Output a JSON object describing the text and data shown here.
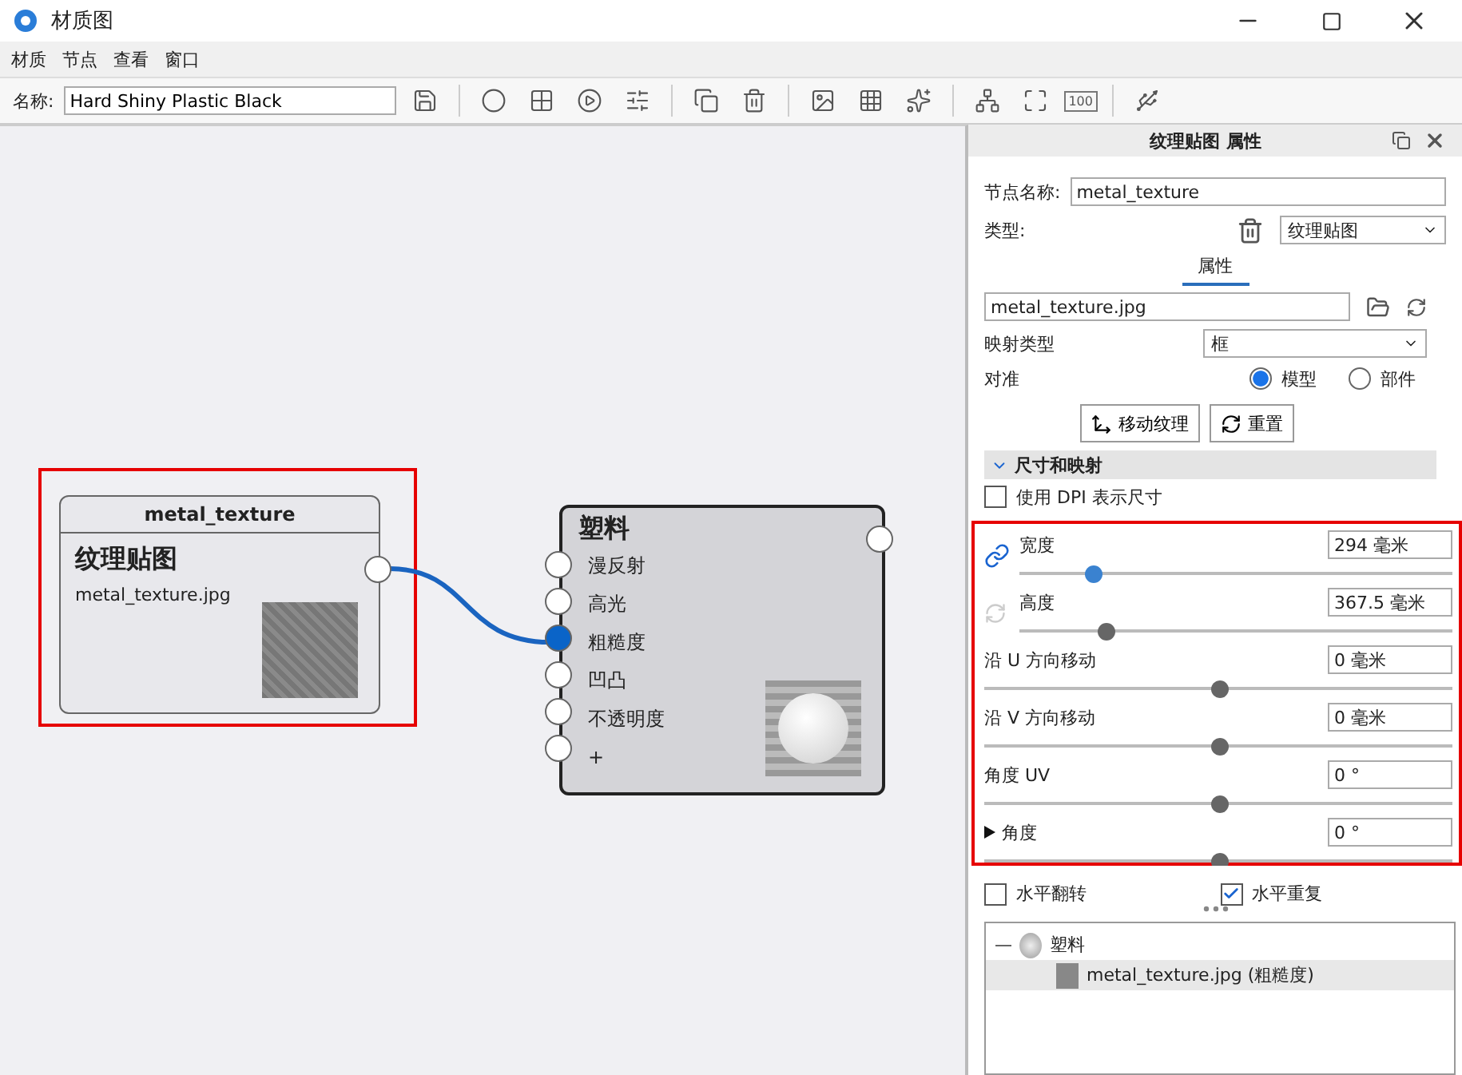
{
  "window": {
    "title": "材质图"
  },
  "menu": [
    {
      "label": "材质"
    },
    {
      "label": "节点"
    },
    {
      "label": "查看"
    },
    {
      "label": "窗口"
    }
  ],
  "toolbar": {
    "name_label": "名称:",
    "name_value": "Hard Shiny Plastic Black",
    "zoom_label": "100"
  },
  "canvas": {
    "nodes": [
      {
        "kind": "texture",
        "title": "metal_texture",
        "type": "纹理贴图",
        "file": "metal_texture.jpg",
        "highlighted": true
      },
      {
        "kind": "material",
        "title": "塑料",
        "inputs": [
          {
            "label": "漫反射",
            "connected": false
          },
          {
            "label": "高光",
            "connected": false
          },
          {
            "label": "粗糙度",
            "connected": true
          },
          {
            "label": "凹凸",
            "connected": false
          },
          {
            "label": "不透明度",
            "connected": false
          },
          {
            "label": "+",
            "connected": false
          }
        ]
      }
    ]
  },
  "panel": {
    "title": "纹理贴图 属性",
    "node_name_label": "节点名称:",
    "node_name": "metal_texture",
    "type_label": "类型:",
    "type_value": "纹理贴图",
    "tabs": [
      {
        "label": "属性",
        "selected": true
      }
    ],
    "file": "metal_texture.jpg",
    "mapping_label": "映射类型",
    "mapping_value": "框",
    "align_label": "对准",
    "align_options": [
      {
        "label": "模型",
        "selected": true
      },
      {
        "label": "部件",
        "selected": false
      }
    ],
    "buttons": [
      {
        "kind": "move",
        "label": "移动纹理"
      },
      {
        "kind": "reset",
        "label": "重置"
      }
    ],
    "section": {
      "title": "尺寸和映射",
      "expanded": true
    },
    "dpi": {
      "label": "使用 DPI 表示尺寸",
      "checked": false
    },
    "sliders_highlighted": true,
    "sliders": [
      {
        "kind": "linked",
        "label": "宽度",
        "value": "294 毫米",
        "level": 0.17
      },
      {
        "kind": "sync",
        "label": "高度",
        "value": "367.5 毫米",
        "level": 0.2
      },
      {
        "kind": "plain",
        "label": "沿 U 方向移动",
        "value": "0 毫米",
        "level": 0.5
      },
      {
        "kind": "plain",
        "label": "沿 V 方向移动",
        "value": "0 毫米",
        "level": 0.5
      },
      {
        "kind": "plain",
        "label": "角度 UV",
        "value": "0 °",
        "level": 0.5
      },
      {
        "kind": "group",
        "label": "角度",
        "value": "0 °",
        "level": 0.5,
        "expanded": false
      }
    ],
    "options": [
      {
        "label": "水平翻转",
        "checked": false
      },
      {
        "label": "水平重复",
        "checked": true
      }
    ],
    "tree": [
      {
        "label": "塑料",
        "expanded": true,
        "selected": false,
        "children": [
          {
            "label": "metal_texture.jpg (粗糙度)",
            "selected": true
          }
        ]
      }
    ]
  }
}
